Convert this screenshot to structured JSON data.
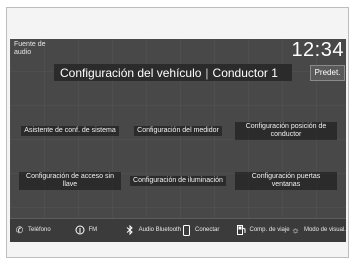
{
  "status": {
    "audio_source": "Fuente de audio",
    "clock": "12:34"
  },
  "title": {
    "main": "Configuración del vehículo",
    "separator": "|",
    "driver": "Conductor 1"
  },
  "preset_button": "Predet.",
  "tiles": [
    {
      "label": "Asistente de conf. de sistema"
    },
    {
      "label": "Configuración del medidor"
    },
    {
      "label": "Configuración posición de conductor"
    },
    {
      "label": "Configuración de acceso sin llave"
    },
    {
      "label": "Configuración de iluminación"
    },
    {
      "label": "Configuración puertas ventanas"
    }
  ],
  "bottom_bar": [
    {
      "icon": "phone-icon",
      "label": "Teléfono"
    },
    {
      "icon": "radio-icon",
      "label": "FM"
    },
    {
      "icon": "bluetooth-icon",
      "label": "Audio Bluetooth"
    },
    {
      "icon": "smartphone-icon",
      "label": "Conectar"
    },
    {
      "icon": "fuel-icon",
      "label": "Comp. de viaje"
    },
    {
      "icon": "display-mode-icon",
      "label": "Modo de visual."
    }
  ],
  "colors": {
    "screen_bg": "#484848",
    "title_bg": "#2b2b2b",
    "bar_bg": "#3b3b3b"
  }
}
